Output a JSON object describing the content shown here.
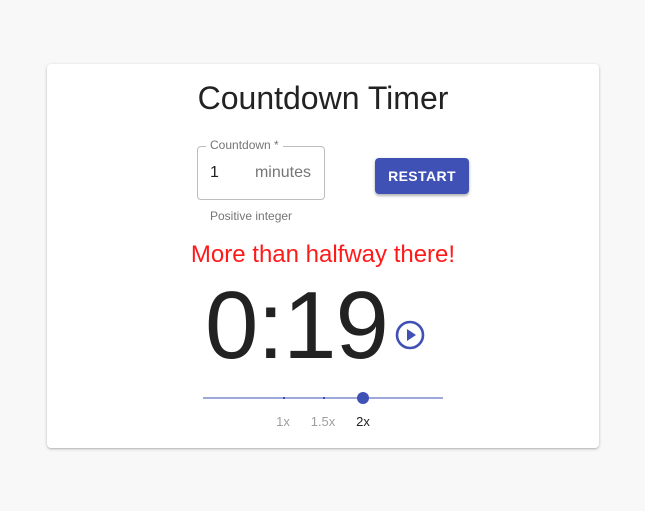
{
  "title": "Countdown Timer",
  "countdown_field": {
    "label": "Countdown *",
    "value": "1",
    "unit": "minutes",
    "helper": "Positive integer"
  },
  "restart_label": "RESTART",
  "status_message": "More than halfway there!",
  "time_display": "0:19",
  "speed_slider": {
    "options": [
      "1x",
      "1.5x",
      "2x"
    ],
    "selected": "2x"
  },
  "colors": {
    "primary": "#3f51b5",
    "status": "#ff1a1a"
  },
  "icons": {
    "play": "play-circle-outline-icon"
  }
}
